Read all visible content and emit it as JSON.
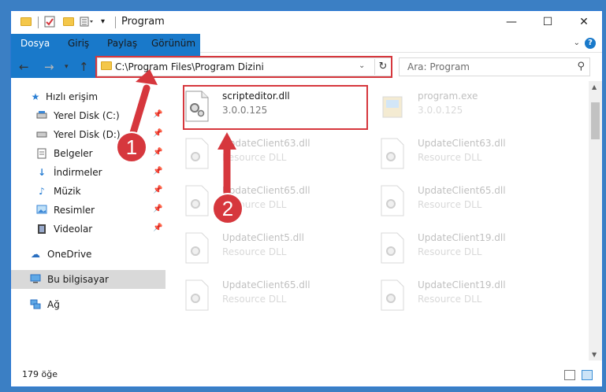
{
  "window": {
    "title": "Program",
    "minimize": "—",
    "maximize": "☐",
    "close": "✕"
  },
  "ribbon": {
    "tabs": [
      "Dosya",
      "Giriş",
      "Paylaş",
      "Görünüm"
    ],
    "help": "?"
  },
  "address": {
    "path": "C:\\Program Files\\Program Dizini"
  },
  "search": {
    "placeholder": "Ara: Program"
  },
  "nav": {
    "items": [
      {
        "label": "Hızlı erişim",
        "icon": "star-icon"
      },
      {
        "label": "Yerel Disk (C:)",
        "icon": "drive-icon",
        "pinned": true
      },
      {
        "label": "Yerel Disk (D:)",
        "icon": "drive-icon",
        "pinned": true
      },
      {
        "label": "Belgeler",
        "icon": "documents-icon",
        "pinned": true
      },
      {
        "label": "İndirmeler",
        "icon": "download-icon",
        "pinned": true
      },
      {
        "label": "Müzik",
        "icon": "music-icon",
        "pinned": true
      },
      {
        "label": "Resimler",
        "icon": "pictures-icon",
        "pinned": true
      },
      {
        "label": "Videolar",
        "icon": "video-icon",
        "pinned": true
      },
      {
        "label": "OneDrive",
        "icon": "cloud-icon"
      },
      {
        "label": "Bu bilgisayar",
        "icon": "computer-icon",
        "selected": true
      },
      {
        "label": "Ağ",
        "icon": "network-icon"
      }
    ]
  },
  "files": [
    {
      "name": "scripteditor.dll",
      "sub": "3.0.0.125",
      "highlight": true
    },
    {
      "name": "program.exe",
      "sub": "3.0.0.125"
    },
    {
      "name": "UpdateClient63.dll",
      "sub": "Resource DLL"
    },
    {
      "name": "UpdateClient63.dll",
      "sub": "Resource DLL"
    },
    {
      "name": "UpdateClient65.dll",
      "sub": "Resource DLL"
    },
    {
      "name": "UpdateClient65.dll",
      "sub": "Resource DLL"
    },
    {
      "name": "UpdateClient5.dll",
      "sub": "Resource DLL"
    },
    {
      "name": "UpdateClient19.dll",
      "sub": "Resource DLL"
    },
    {
      "name": "UpdateClient65.dll",
      "sub": "Resource DLL"
    },
    {
      "name": "UpdateClient19.dll",
      "sub": "Resource DLL"
    }
  ],
  "status": {
    "count": "179 öğe"
  },
  "annotations": {
    "step1": "1",
    "step2": "2",
    "color": "#d6373d"
  }
}
